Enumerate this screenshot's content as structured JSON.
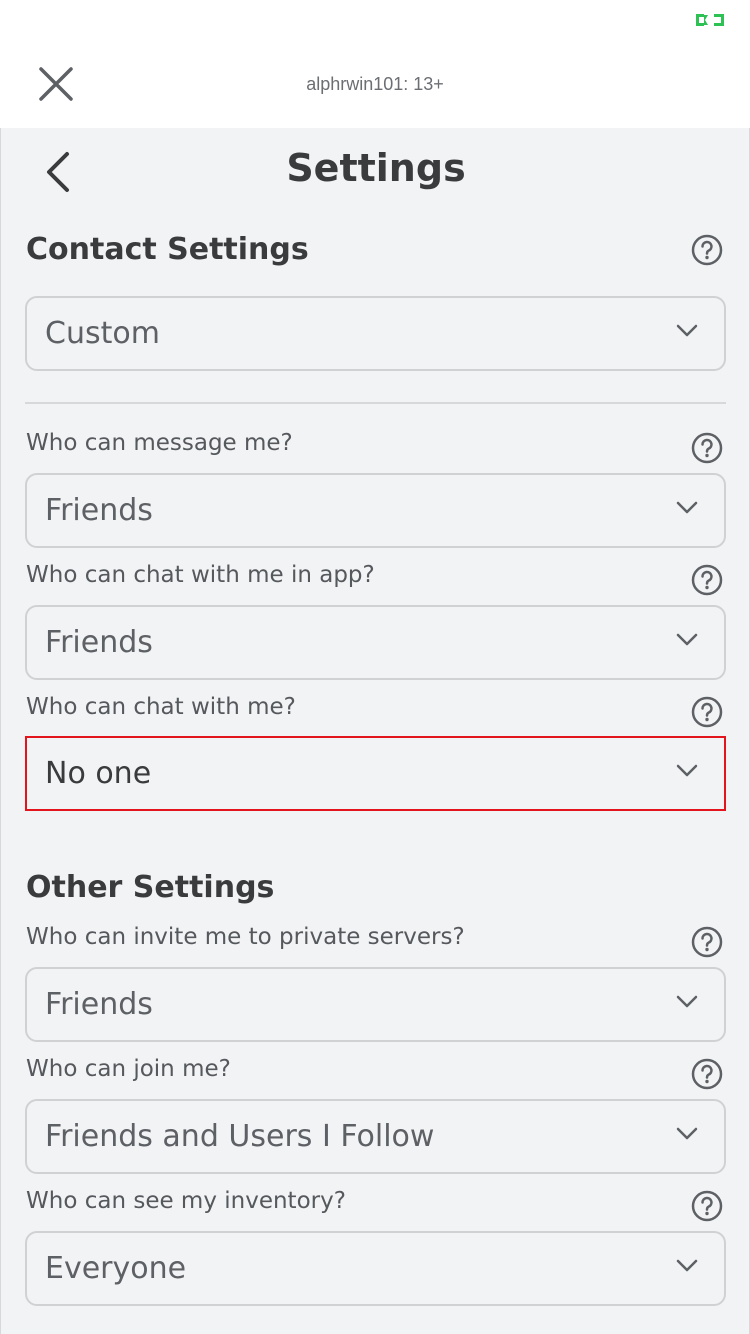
{
  "header": {
    "username": "alphrwin101: 13+",
    "accent_color": "#2ec255"
  },
  "page": {
    "title": "Settings"
  },
  "contact_settings": {
    "title": "Contact Settings",
    "preset_value": "Custom",
    "fields": [
      {
        "label": "Who can message me?",
        "value": "Friends"
      },
      {
        "label": "Who can chat with me in app?",
        "value": "Friends"
      },
      {
        "label": "Who can chat with me?",
        "value": "No one"
      }
    ]
  },
  "other_settings": {
    "title": "Other Settings",
    "fields": [
      {
        "label": "Who can invite me to private servers?",
        "value": "Friends"
      },
      {
        "label": "Who can join me?",
        "value": "Friends and Users I Follow"
      },
      {
        "label": "Who can see my inventory?",
        "value": "Everyone"
      }
    ]
  },
  "highlight_color": "#e4141c",
  "icons": {
    "close": "close-icon",
    "back": "chevron-left-icon",
    "help": "question-circle-icon",
    "dropdown": "chevron-down-icon",
    "battery": "battery-icon"
  }
}
